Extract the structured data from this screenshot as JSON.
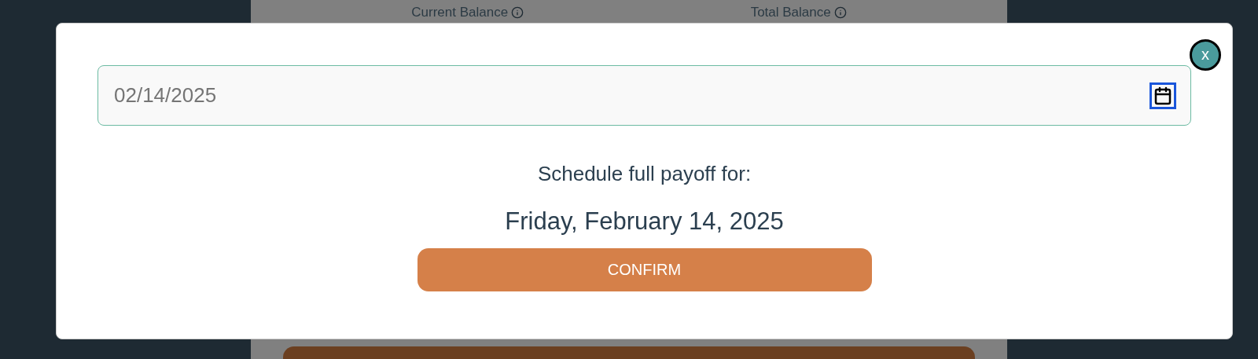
{
  "background": {
    "balances": [
      {
        "label": "Current Balance"
      },
      {
        "label": "Total Balance"
      }
    ]
  },
  "modal": {
    "close_label": "x",
    "date_field": {
      "value": "02/14/2025",
      "focused_icon": true
    },
    "prompt": "Schedule full payoff for:",
    "selected_date": "Friday, February 14, 2025",
    "confirm_button": "CONFIRM"
  }
}
